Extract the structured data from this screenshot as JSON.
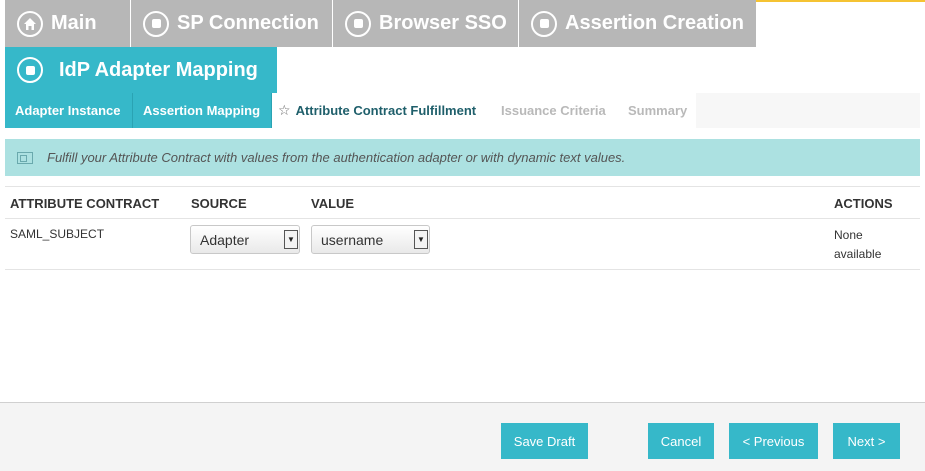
{
  "topnav": {
    "main": "Main",
    "sp_connection": "SP Connection",
    "browser_sso": "Browser SSO",
    "assertion_creation": "Assertion Creation"
  },
  "section": {
    "title": "IdP Adapter Mapping"
  },
  "subtabs": {
    "adapter_instance": "Adapter Instance",
    "assertion_mapping": "Assertion Mapping",
    "attribute_contract_fulfillment": "Attribute Contract Fulfillment",
    "issuance_criteria": "Issuance Criteria",
    "summary": "Summary"
  },
  "info": {
    "text": "Fulfill your Attribute Contract with values from the authentication adapter or with dynamic text values."
  },
  "table": {
    "headers": {
      "attribute_contract": "ATTRIBUTE CONTRACT",
      "source": "SOURCE",
      "value": "VALUE",
      "actions": "ACTIONS"
    },
    "rows": [
      {
        "attribute": "SAML_SUBJECT",
        "source": "Adapter",
        "value": "username",
        "actions": "None available"
      }
    ]
  },
  "footer": {
    "save_draft": "Save Draft",
    "cancel": "Cancel",
    "previous": "< Previous",
    "next": "Next >"
  },
  "colors": {
    "accent": "#36b8c9",
    "inactive_tab": "#b7b7b7",
    "info_bar": "#ace1e1",
    "top_strip": "#f5c332"
  }
}
